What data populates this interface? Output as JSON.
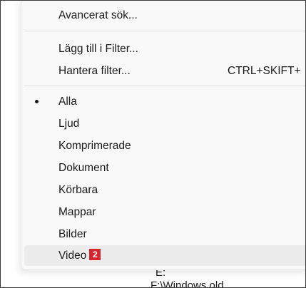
{
  "background": {
    "lines": [
      "E:",
      "F:\\Windows.old"
    ]
  },
  "menu": {
    "top_item": {
      "label": "Avancerat sök..."
    },
    "filter_items": [
      {
        "label": "Lägg till i Filter..."
      },
      {
        "label": "Hantera filter...",
        "shortcut": "CTRL+SKIFT+"
      }
    ],
    "type_items": [
      {
        "label": "Alla",
        "selected": true
      },
      {
        "label": "Ljud"
      },
      {
        "label": "Komprimerade"
      },
      {
        "label": "Dokument"
      },
      {
        "label": "Körbara"
      },
      {
        "label": "Mappar"
      },
      {
        "label": "Bilder"
      },
      {
        "label": "Video",
        "highlighted": true,
        "badge": "2"
      }
    ]
  },
  "colors": {
    "menu_bg": "#f9f9f9",
    "hover_bg": "#ececec",
    "badge_bg": "#d9262e",
    "badge_text": "#ffffff"
  }
}
